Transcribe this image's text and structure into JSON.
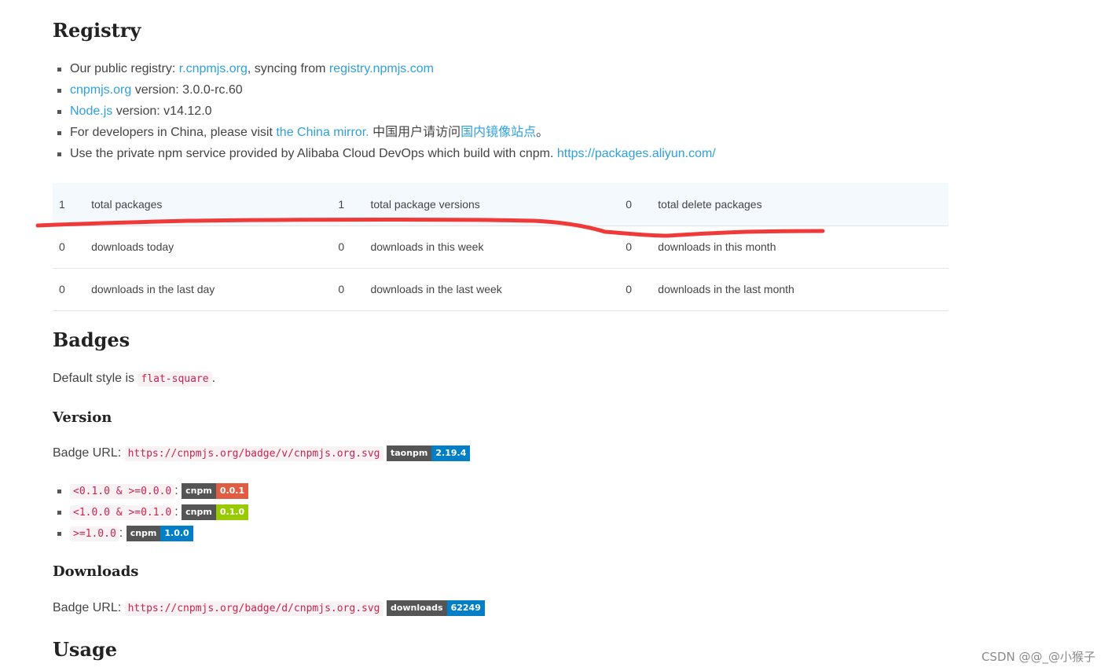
{
  "registry": {
    "title": "Registry",
    "items": [
      {
        "pre": "Our public registry: ",
        "link1": "r.cnpmjs.org",
        "mid": ", syncing from ",
        "link2": "registry.npmjs.com"
      },
      {
        "link": "cnpmjs.org",
        "post": " version: 3.0.0-rc.60"
      },
      {
        "link": "Node.js",
        "post": " version: v14.12.0"
      },
      {
        "pre": "For developers in China, please visit ",
        "link1": "the China mirror.",
        "mid": " 中国用户请访问",
        "link2": "国内镜像站点",
        "post": "。"
      },
      {
        "pre": "Use the private npm service provided by Alibaba Cloud DevOps which build with cnpm. ",
        "link": "https://packages.aliyun.com/"
      }
    ]
  },
  "stats": {
    "rows": [
      [
        {
          "num": "1",
          "label": "total packages"
        },
        {
          "num": "1",
          "label": "total package versions"
        },
        {
          "num": "0",
          "label": "total delete packages"
        }
      ],
      [
        {
          "num": "0",
          "label": "downloads today"
        },
        {
          "num": "0",
          "label": "downloads in this week"
        },
        {
          "num": "0",
          "label": "downloads in this month"
        }
      ],
      [
        {
          "num": "0",
          "label": "downloads in the last day"
        },
        {
          "num": "0",
          "label": "downloads in the last week"
        },
        {
          "num": "0",
          "label": "downloads in the last month"
        }
      ]
    ]
  },
  "badges": {
    "title": "Badges",
    "default_pre": "Default style is ",
    "default_code": "flat-square",
    "default_post": "."
  },
  "version": {
    "title": "Version",
    "url_label": "Badge URL: ",
    "url": "https://cnpmjs.org/badge/v/cnpmjs.org.svg",
    "badge": {
      "left": "taonpm",
      "right": "2.19.4",
      "color": "#007ec6"
    },
    "ranges": [
      {
        "code": "<0.1.0 & >=0.0.0",
        "left": "cnpm",
        "right": "0.0.1",
        "color": "#e05d44"
      },
      {
        "code": "<1.0.0 & >=0.1.0",
        "left": "cnpm",
        "right": "0.1.0",
        "color": "#97ca00"
      },
      {
        "code": ">=1.0.0",
        "left": "cnpm",
        "right": "1.0.0",
        "color": "#007ec6"
      }
    ]
  },
  "downloads": {
    "title": "Downloads",
    "url_label": "Badge URL: ",
    "url": "https://cnpmjs.org/badge/d/cnpmjs.org.svg",
    "badge": {
      "left": "downloads",
      "right": "62249",
      "color": "#007ec6"
    }
  },
  "usage": {
    "title": "Usage"
  },
  "watermark": "CSDN @@_@小猴子",
  "annotation": {
    "color": "#f03a3a"
  }
}
